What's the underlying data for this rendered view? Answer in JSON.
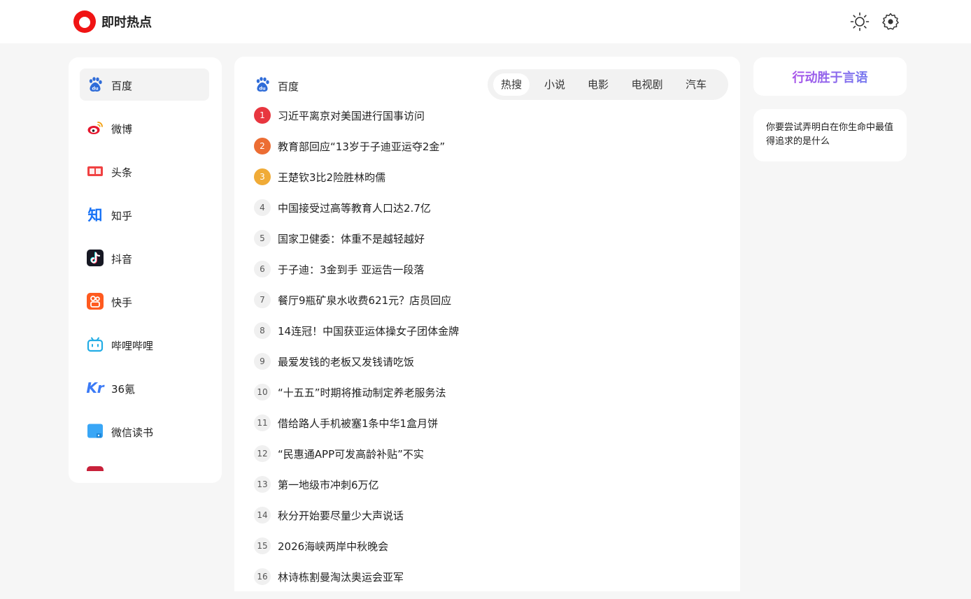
{
  "app": {
    "title": "即时热点"
  },
  "sidebar": {
    "items": [
      {
        "label": "百度",
        "icon": "baidu-icon",
        "color": "#2f6cd8",
        "active": true
      },
      {
        "label": "微博",
        "icon": "weibo-icon",
        "color": "#e6162d"
      },
      {
        "label": "头条",
        "icon": "toutiao-icon",
        "color": "#f04142"
      },
      {
        "label": "知乎",
        "icon": "zhihu-icon",
        "color": "#1772f6"
      },
      {
        "label": "抖音",
        "icon": "douyin-icon",
        "color": "#161823"
      },
      {
        "label": "快手",
        "icon": "kuaishou-icon",
        "color": "#ff5a1f"
      },
      {
        "label": "哔哩哔哩",
        "icon": "bilibili-icon",
        "color": "#23ade5"
      },
      {
        "label": "36氪",
        "icon": "36kr-icon",
        "color": "#3b7af6"
      },
      {
        "label": "微信读书",
        "icon": "weread-icon",
        "color": "#39a6f6"
      },
      {
        "label": "",
        "icon": "partial-item-icon",
        "color": "#c8213a"
      }
    ]
  },
  "main": {
    "source_label": "百度",
    "tabs": [
      {
        "label": "热搜",
        "active": true
      },
      {
        "label": "小说"
      },
      {
        "label": "电影"
      },
      {
        "label": "电视剧"
      },
      {
        "label": "汽车"
      }
    ],
    "items": [
      {
        "rank": "1",
        "title": "习近平离京对美国进行国事访问"
      },
      {
        "rank": "2",
        "title": "教育部回应“13岁于子迪亚运夺2金”"
      },
      {
        "rank": "3",
        "title": "王楚钦3比2险胜林昀儒"
      },
      {
        "rank": "4",
        "title": "中国接受过高等教育人口达2.7亿"
      },
      {
        "rank": "5",
        "title": "国家卫健委：体重不是越轻越好"
      },
      {
        "rank": "6",
        "title": "于子迪：3金到手 亚运告一段落"
      },
      {
        "rank": "7",
        "title": "餐厅9瓶矿泉水收费621元？店员回应"
      },
      {
        "rank": "8",
        "title": "14连冠！中国获亚运体操女子团体金牌"
      },
      {
        "rank": "9",
        "title": "最爱发钱的老板又发钱请吃饭"
      },
      {
        "rank": "10",
        "title": "“十五五”时期将推动制定养老服务法"
      },
      {
        "rank": "11",
        "title": "借给路人手机被塞1条中华1盒月饼"
      },
      {
        "rank": "12",
        "title": "“民惠通APP可发高龄补贴”不实"
      },
      {
        "rank": "13",
        "title": "第一地级市冲刺6万亿"
      },
      {
        "rank": "14",
        "title": "秋分开始要尽量少大声说话"
      },
      {
        "rank": "15",
        "title": "2026海峡两岸中秋晚会"
      },
      {
        "rank": "16",
        "title": "林诗栋割曼淘汰奥运会亚军"
      }
    ],
    "rank_colors": [
      "#e8363f",
      "#ec6d33",
      "#f0ab37"
    ]
  },
  "right": {
    "motto": "行动胜于言语",
    "quote": "你要尝试弄明白在你生命中最值得追求的是什么"
  }
}
